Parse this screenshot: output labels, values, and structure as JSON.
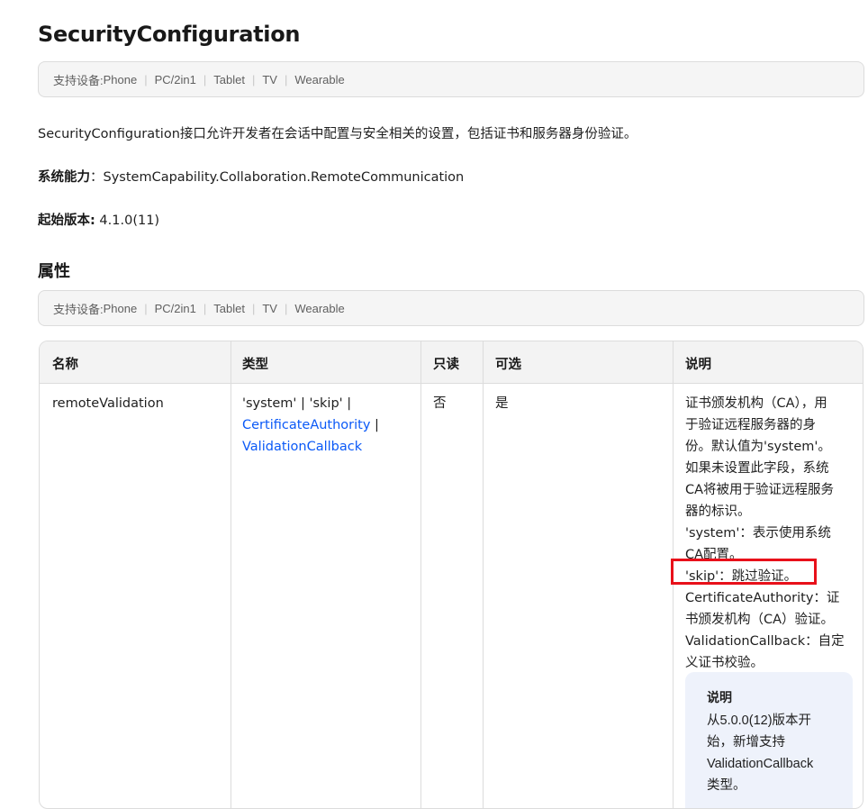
{
  "page": {
    "title": "SecurityConfiguration",
    "device_support_label": "支持设备: ",
    "devices": [
      "Phone",
      "PC/2in1",
      "Tablet",
      "TV",
      "Wearable"
    ],
    "description": "SecurityConfiguration接口允许开发者在会话中配置与安全相关的设置，包括证书和服务器身份验证。",
    "capability_label": "系统能力",
    "capability_value": "SystemCapability.Collaboration.RemoteCommunication",
    "since_label": "起始版本:",
    "since_value": "4.1.0(11)",
    "attributes_title": "属性"
  },
  "table": {
    "headers": [
      "名称",
      "类型",
      "只读",
      "可选",
      "说明"
    ],
    "row": {
      "name": "remoteValidation",
      "type_prefix": "'system' | 'skip' |",
      "type_link1": "CertificateAuthority",
      "type_sep": " |",
      "type_link2": "ValidationCallback",
      "readonly": "否",
      "optional": "是",
      "desc_lines": [
        "证书颁发机构（CA），用",
        "于验证远程服务器的身",
        "份。默认值为'system'。",
        "如果未设置此字段，系统",
        "CA将被用于验证远程服务",
        "器的标识。",
        "'system'：表示使用系统",
        "CA配置。",
        "'skip'：跳过验证。",
        "CertificateAuthority：证",
        "书颁发机构（CA）验证。",
        "ValidationCallback：自定",
        "义证书校验。"
      ],
      "note_title": "说明",
      "note_lines": [
        "从5.0.0(12)版本开",
        "始，新增支持",
        "ValidationCallback",
        "类型。"
      ]
    }
  }
}
